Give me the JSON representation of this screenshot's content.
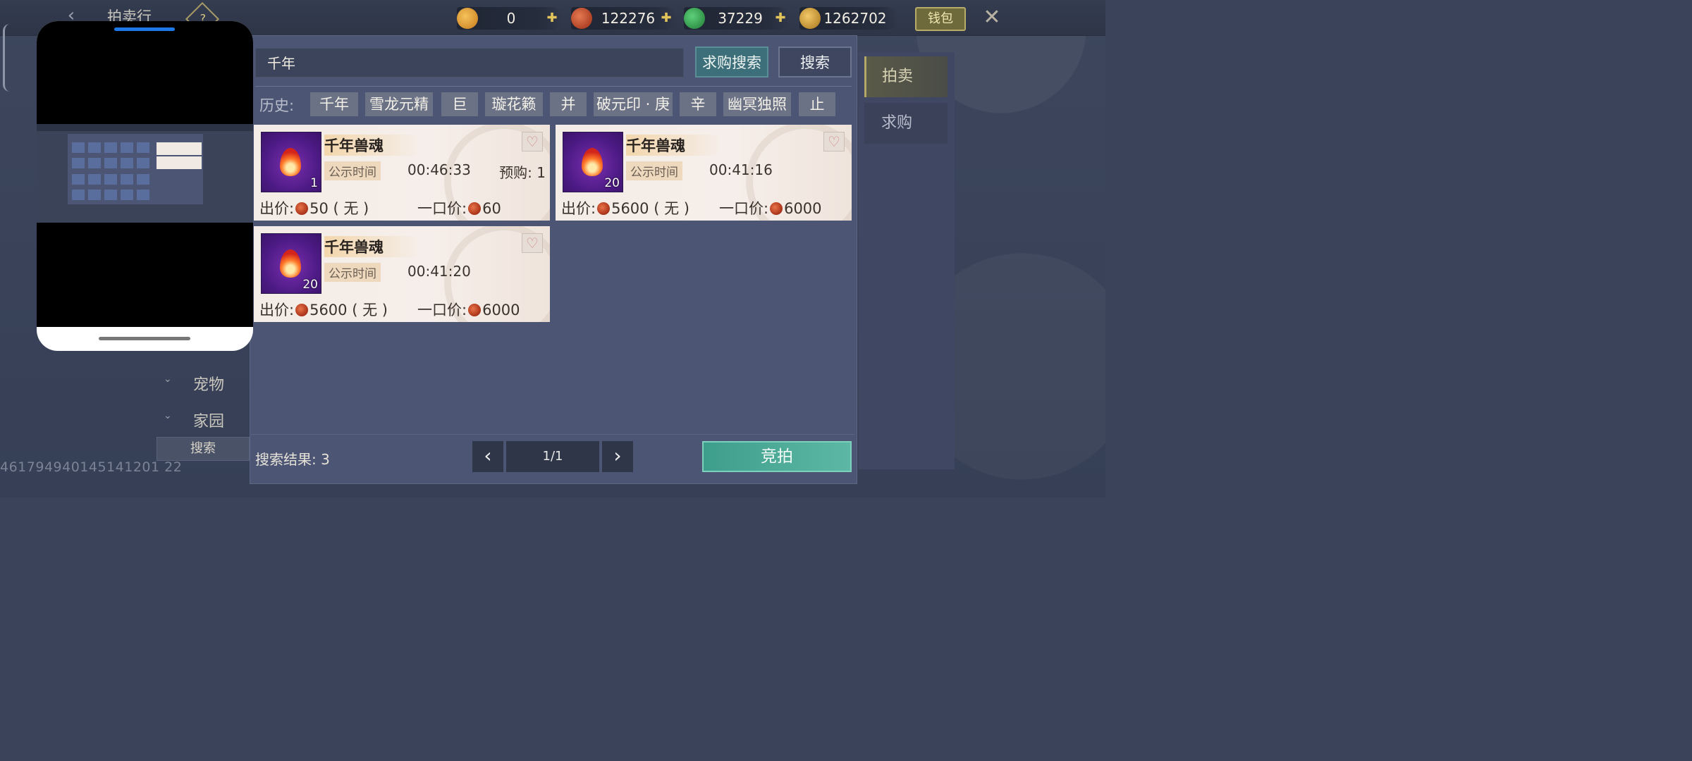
{
  "header": {
    "title": "拍卖行",
    "help_symbol": "?",
    "currencies": [
      {
        "icon": "gold-ingot-icon",
        "value": "0",
        "color": "#e7a53a",
        "has_plus": true
      },
      {
        "icon": "copper-coin-icon",
        "value": "122276",
        "color": "#c94a2a",
        "has_plus": true
      },
      {
        "icon": "jade-coin-icon",
        "value": "37229",
        "color": "#2fa24a",
        "has_plus": true
      },
      {
        "icon": "gold-leaf-icon",
        "value": "1262702",
        "color": "#d7a640",
        "has_plus": false
      }
    ],
    "wallet_label": "钱包",
    "close_symbol": "✕"
  },
  "search": {
    "query": "千年",
    "buy_search_label": "求购搜索",
    "search_label": "搜索"
  },
  "history": {
    "label": "历史:",
    "items": [
      "千年",
      "雪龙元精",
      "巨",
      "璇花籁",
      "并",
      "破元印 · 庚",
      "辛",
      "幽冥独照",
      "止"
    ]
  },
  "listings": [
    {
      "name": "千年兽魂",
      "qty": "1",
      "pub_label": "公示时间",
      "pub_time": "00:46:33",
      "preorder": "预购: 1",
      "bid_label": "出价:",
      "bid": "50 ( 无 )",
      "buyout_label": "一口价:",
      "buyout": "60"
    },
    {
      "name": "千年兽魂",
      "qty": "20",
      "pub_label": "公示时间",
      "pub_time": "00:41:16",
      "preorder": "",
      "bid_label": "出价:",
      "bid": "5600 ( 无 )",
      "buyout_label": "一口价:",
      "buyout": "6000"
    },
    {
      "name": "千年兽魂",
      "qty": "20",
      "pub_label": "公示时间",
      "pub_time": "00:41:20",
      "preorder": "",
      "bid_label": "出价:",
      "bid": "5600 ( 无 )",
      "buyout_label": "一口价:",
      "buyout": "6000"
    }
  ],
  "footer": {
    "result_label": "搜索结果: 3",
    "page_indicator": "1/1",
    "bid_button": "竞拍"
  },
  "right_tabs": {
    "auction": "拍卖",
    "buy_request": "求购"
  },
  "left_nav": {
    "items": [
      "宠物",
      "家园"
    ],
    "search_button": "搜索"
  },
  "debug_id": "461794940145141201 22"
}
